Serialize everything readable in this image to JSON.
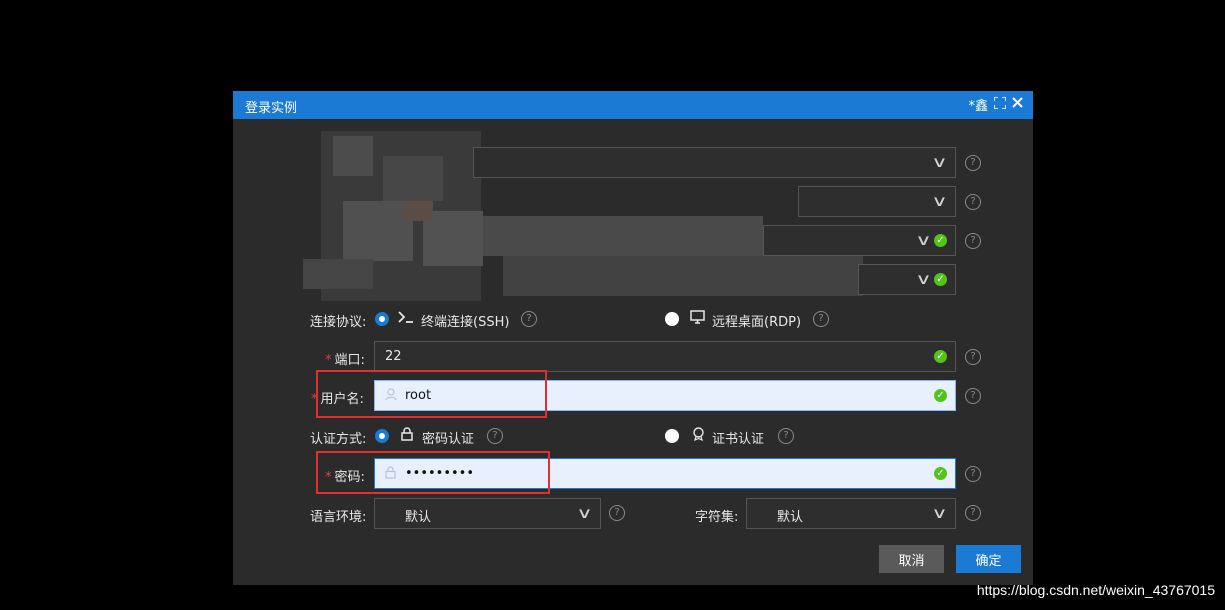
{
  "dialog": {
    "title": "登录实例",
    "title_right_text": "*鑫"
  },
  "protocol": {
    "label": "连接协议:",
    "ssh_label": "终端连接(SSH)",
    "rdp_label": "远程桌面(RDP)",
    "selected": "ssh"
  },
  "port": {
    "label": "端口:",
    "value": "22"
  },
  "username": {
    "label": "用户名:",
    "value": "root"
  },
  "auth": {
    "label": "认证方式:",
    "password_label": "密码认证",
    "cert_label": "证书认证",
    "selected": "password"
  },
  "password": {
    "label": "密码:",
    "value": "•••••••••"
  },
  "locale": {
    "label": "语言环境:",
    "value": "默认"
  },
  "charset": {
    "label": "字符集:",
    "value": "默认"
  },
  "buttons": {
    "cancel": "取消",
    "confirm": "确定"
  },
  "watermark": "https://blog.csdn.net/weixin_43767015",
  "colors": {
    "accent": "#1a7ad4",
    "success": "#52c41a",
    "highlight": "#e03030"
  },
  "icons": {
    "close": "close-icon",
    "fullscreen": "fullscreen-icon",
    "terminal": "terminal-icon",
    "monitor": "monitor-icon",
    "lock": "lock-icon",
    "certificate": "certificate-icon",
    "user": "user-icon",
    "help": "help-icon",
    "check": "check-circle-icon",
    "chevron": "chevron-down-icon"
  }
}
